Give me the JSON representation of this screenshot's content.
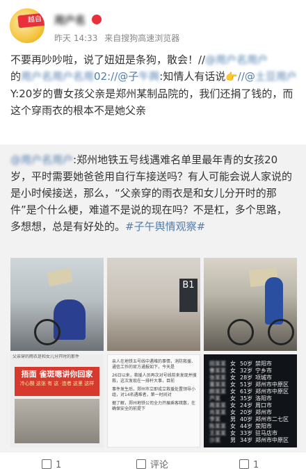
{
  "post": {
    "avatar_badge": "越自",
    "username": "用户名",
    "time": "昨天 14:33",
    "source": "来自搜狗高速浏览器",
    "text_1": "不要再吵吵啦，说了妞妞是条狗，散会！//",
    "mention_1": "@用户名用户",
    "text_2": "的",
    "mention_2": "用户名用户名用",
    "text_3": "02:",
    "mention_3": "//@子",
    "mention_3b": "午舆",
    "text_4": ":知情人有话说",
    "hand": "👉",
    "mention_4": "//@",
    "mention_4b": "土豆用户",
    "text_5": "Y:20岁的曹女孩父亲是郑州某制品院的，我们还捐了钱的，而这个穿雨衣的根本不是她父亲"
  },
  "quote": {
    "mention": "@用户名用户",
    "text": ":郑州地铁五号线遇难名单里最年青的女孩20岁，平时需要她爸爸用自行车接送吗？有人可能会说人家说的是小时候接送，那么，“父亲穿的雨衣是和女儿分开时的那件”是个什么梗，难道不是说的现在吗？不是杠，多个思路，多想想，总是有好处的。",
    "hashtag": "#子午舆情观察#"
  },
  "images": {
    "sign_b1": "B1",
    "poster_header": "父亲穿的雨衣是和女儿分开时的那件",
    "poster_title": "捂面 雀斑嗯讲你回家",
    "poster_sub": "冷心酸 这张 有 这 ·连者 这里 这样",
    "article": [
      "亲人在地铁五号线中遇难的事情，消防救援、通信工作的官方通报如下，今天是",
      "26日以来，救援人员再次对号线前来发现并搜救，这次发现在一排杆大事，目前",
      "事件发生后，郑州市立即成立救援处置领导小组，对14名遇难者，第一时间对",
      "据了解，郑州地铁公司全力开展乘客疏散，在确保安全的前提下"
    ],
    "victims": [
      {
        "name": "田某某",
        "sex": "女",
        "age": "50岁",
        "city": "禁阳市"
      },
      {
        "name": "曹某某",
        "sex": "女",
        "age": "32岁",
        "city": "宁乡市"
      },
      {
        "name": "张某某",
        "sex": "女",
        "age": "28岁",
        "city": "项城市"
      },
      {
        "name": "董某某",
        "sex": "女",
        "age": "51岁",
        "city": "郑州市中原区"
      },
      {
        "name": "颜某某",
        "sex": "女",
        "age": "61岁",
        "city": "郑州市中原区"
      },
      {
        "name": "芦某",
        "sex": "女",
        "age": "35岁",
        "city": "洛阳市"
      },
      {
        "name": "周某某",
        "sex": "女",
        "age": "24岁",
        "city": "周口市"
      },
      {
        "name": "肖某某",
        "sex": "女",
        "age": "20岁",
        "city": "郑州市"
      },
      {
        "name": "李某",
        "sex": "男",
        "age": "40岁",
        "city": "郑州市二七区"
      },
      {
        "name": "陈某某",
        "sex": "女",
        "age": "44岁",
        "city": "荥阳市"
      },
      {
        "name": "王某某",
        "sex": "女",
        "age": "33岁",
        "city": "驻马店市"
      },
      {
        "name": "沙某",
        "sex": "男",
        "age": "34岁",
        "city": "郑州市中原区"
      }
    ]
  },
  "footer": {
    "repost": "1",
    "comment": "评论",
    "like": "1"
  }
}
